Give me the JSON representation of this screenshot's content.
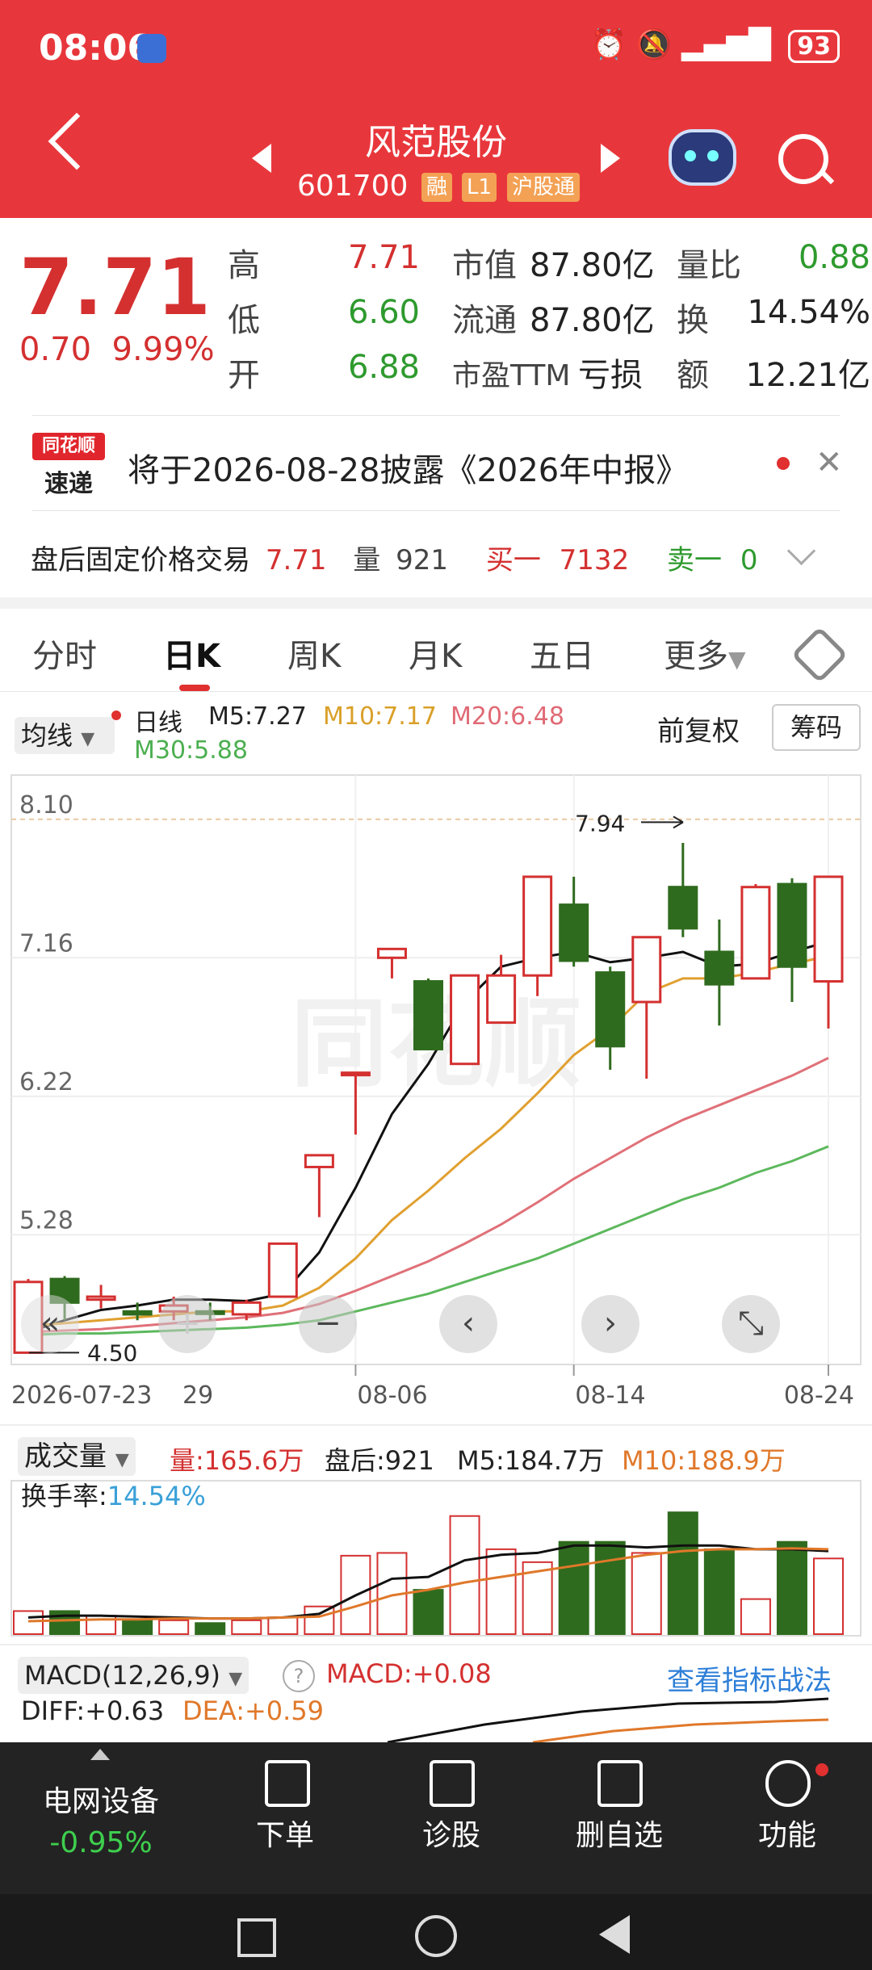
{
  "status": {
    "time": "08:06",
    "battery": "93"
  },
  "header": {
    "name": "风范股份",
    "code": "601700",
    "tags": [
      "融",
      "L1",
      "沪股通"
    ]
  },
  "quote": {
    "price": "7.71",
    "change": "0.70",
    "pct": "9.99%",
    "rows": [
      {
        "l1": "高",
        "v1": "7.71",
        "l2": "市值",
        "v2": "87.80亿",
        "l3": "量比",
        "v3": "0.88"
      },
      {
        "l1": "低",
        "v1": "6.60",
        "l2": "流通",
        "v2": "87.80亿",
        "l3": "换",
        "v3": "14.54%"
      },
      {
        "l1": "开",
        "v1": "6.88",
        "l2": "市盈TTM",
        "v2": "亏损",
        "l3": "额",
        "v3": "12.21亿"
      }
    ]
  },
  "notice": {
    "logo_top": "同花顺",
    "logo_bottom": "速递",
    "text": "将于2026-08-28披露《2026年中报》"
  },
  "after_hours": {
    "label": "盘后固定价格交易",
    "price": "7.71",
    "vol_label": "量",
    "vol": "921",
    "buy_label": "买一",
    "buy": "7132",
    "sell_label": "卖一",
    "sell": "0"
  },
  "tabs": [
    "分时",
    "日K",
    "周K",
    "月K",
    "五日",
    "更多"
  ],
  "legend": {
    "mode": "均线",
    "line": "日线",
    "m5": "M5:7.27",
    "m10": "M10:7.17",
    "m20": "M20:6.48",
    "m30": "M30:5.88",
    "adjust": "前复权",
    "chips": "筹码"
  },
  "chart_data": {
    "type": "candlestick",
    "y_ticks": [
      "8.10",
      "7.16",
      "6.22",
      "5.28"
    ],
    "ylim": [
      4.4,
      8.4
    ],
    "x_labels": [
      "2026-07-23",
      "29",
      "08-06",
      "08-14",
      "08-24"
    ],
    "max_label": "7.94",
    "min_label": "4.50",
    "watermark": "同花顺",
    "candles": [
      {
        "o": 4.48,
        "c": 4.96,
        "h": 4.98,
        "l": 4.48,
        "up": true
      },
      {
        "o": 4.98,
        "c": 4.82,
        "h": 5.0,
        "l": 4.7,
        "up": false
      },
      {
        "o": 4.84,
        "c": 4.86,
        "h": 4.94,
        "l": 4.78,
        "up": true
      },
      {
        "o": 4.76,
        "c": 4.74,
        "h": 4.82,
        "l": 4.7,
        "up": false
      },
      {
        "o": 4.76,
        "c": 4.8,
        "h": 4.86,
        "l": 4.7,
        "up": true
      },
      {
        "o": 4.76,
        "c": 4.75,
        "h": 4.82,
        "l": 4.7,
        "up": false
      },
      {
        "o": 4.74,
        "c": 4.82,
        "h": 4.84,
        "l": 4.7,
        "up": true
      },
      {
        "o": 4.86,
        "c": 5.22,
        "h": 5.22,
        "l": 4.86,
        "up": true
      },
      {
        "o": 5.74,
        "c": 5.82,
        "h": 5.82,
        "l": 5.4,
        "up": true
      },
      {
        "o": 6.38,
        "c": 6.38,
        "h": 6.38,
        "l": 5.96,
        "up": true
      },
      {
        "o": 7.16,
        "c": 7.22,
        "h": 7.22,
        "l": 7.02,
        "up": true
      },
      {
        "o": 7.0,
        "c": 6.54,
        "h": 7.02,
        "l": 6.54,
        "up": false
      },
      {
        "o": 6.44,
        "c": 7.04,
        "h": 7.04,
        "l": 6.44,
        "up": true
      },
      {
        "o": 6.72,
        "c": 7.04,
        "h": 7.18,
        "l": 6.72,
        "up": true
      },
      {
        "o": 7.04,
        "c": 7.71,
        "h": 7.71,
        "l": 6.9,
        "up": true
      },
      {
        "o": 7.52,
        "c": 7.14,
        "h": 7.71,
        "l": 7.1,
        "up": false
      },
      {
        "o": 7.06,
        "c": 6.56,
        "h": 7.1,
        "l": 6.4,
        "up": false
      },
      {
        "o": 6.86,
        "c": 7.3,
        "h": 7.3,
        "l": 6.34,
        "up": true
      },
      {
        "o": 7.64,
        "c": 7.36,
        "h": 7.94,
        "l": 7.3,
        "up": false
      },
      {
        "o": 7.2,
        "c": 6.98,
        "h": 7.42,
        "l": 6.7,
        "up": false
      },
      {
        "o": 7.02,
        "c": 7.64,
        "h": 7.66,
        "l": 7.02,
        "up": true
      },
      {
        "o": 7.66,
        "c": 7.1,
        "h": 7.7,
        "l": 6.86,
        "up": false
      },
      {
        "o": 7.0,
        "c": 7.71,
        "h": 7.71,
        "l": 6.68,
        "up": true
      }
    ],
    "series": [
      {
        "name": "M5",
        "color": "#111111",
        "values": [
          4.62,
          4.7,
          4.77,
          4.8,
          4.84,
          4.84,
          4.83,
          4.88,
          5.16,
          5.6,
          6.1,
          6.44,
          6.86,
          7.1,
          7.16,
          7.2,
          7.13,
          7.16,
          7.2,
          7.1,
          7.12,
          7.2,
          7.27
        ]
      },
      {
        "name": "M10",
        "color": "#e0a030",
        "values": [
          4.66,
          4.68,
          4.7,
          4.72,
          4.74,
          4.76,
          4.76,
          4.8,
          4.92,
          5.12,
          5.38,
          5.58,
          5.8,
          6.0,
          6.24,
          6.5,
          6.68,
          6.92,
          7.02,
          7.02,
          7.06,
          7.12,
          7.17
        ]
      },
      {
        "name": "M20",
        "color": "#e07078",
        "values": [
          4.62,
          4.63,
          4.64,
          4.66,
          4.68,
          4.7,
          4.72,
          4.75,
          4.81,
          4.9,
          5.0,
          5.1,
          5.22,
          5.35,
          5.5,
          5.66,
          5.8,
          5.94,
          6.06,
          6.16,
          6.26,
          6.36,
          6.48
        ]
      },
      {
        "name": "M30",
        "color": "#5cb85c",
        "values": [
          4.6,
          4.61,
          4.61,
          4.62,
          4.63,
          4.64,
          4.65,
          4.67,
          4.7,
          4.76,
          4.82,
          4.88,
          4.96,
          5.04,
          5.12,
          5.22,
          5.32,
          5.42,
          5.52,
          5.6,
          5.7,
          5.78,
          5.88
        ]
      }
    ]
  },
  "volume": {
    "label": "成交量",
    "vol": "量:165.6万",
    "after": "盘后:921",
    "m5": "M5:184.7万",
    "m10": "M10:188.9万",
    "turnover_label": "换手率:",
    "turnover": "14.54%",
    "bars": [
      0.25,
      0.25,
      0.2,
      0.15,
      0.15,
      0.12,
      0.15,
      0.18,
      0.3,
      0.85,
      0.88,
      0.48,
      1.28,
      0.92,
      0.78,
      1.0,
      1.0,
      0.88,
      1.32,
      0.92,
      0.38,
      1.0,
      0.82
    ],
    "ma5": [
      0.18,
      0.2,
      0.2,
      0.19,
      0.18,
      0.17,
      0.17,
      0.18,
      0.22,
      0.42,
      0.6,
      0.62,
      0.8,
      0.86,
      0.88,
      0.96,
      0.96,
      0.94,
      0.96,
      0.96,
      0.92,
      0.92,
      0.9
    ],
    "ma10": [
      0.14,
      0.15,
      0.16,
      0.16,
      0.17,
      0.17,
      0.17,
      0.18,
      0.19,
      0.3,
      0.42,
      0.48,
      0.56,
      0.62,
      0.68,
      0.74,
      0.8,
      0.86,
      0.9,
      0.92,
      0.92,
      0.93,
      0.92
    ]
  },
  "macd": {
    "label": "MACD(12,26,9)",
    "help": "?",
    "macd": "MACD:+0.08",
    "link": "查看指标战法",
    "diff": "DIFF:+0.63",
    "dea": "DEA:+0.59"
  },
  "nav": {
    "sector": "电网设备",
    "sector_pct": "-0.95%",
    "items": [
      "下单",
      "诊股",
      "删自选",
      "功能"
    ]
  }
}
